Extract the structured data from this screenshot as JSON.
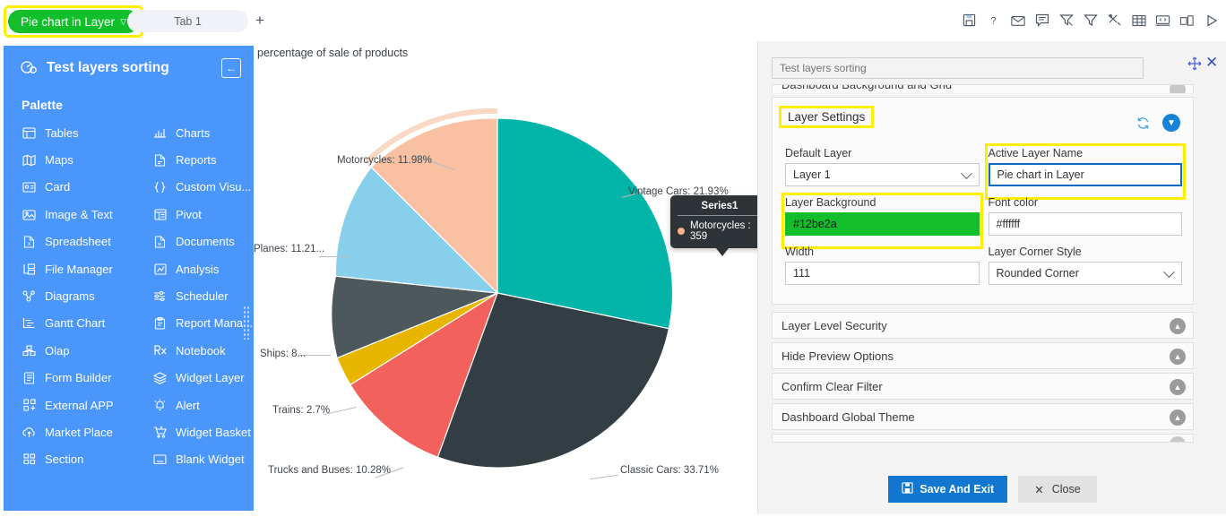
{
  "topbar": {
    "layer_pill": {
      "label": "Pie chart in Layer",
      "caret": "chevron-down-icon",
      "bg": "#12be2a"
    },
    "tab": {
      "label": "Tab 1"
    },
    "add_tab_label": "+",
    "icons": [
      {
        "name": "save-icon"
      },
      {
        "name": "help-icon"
      },
      {
        "name": "mail-icon"
      },
      {
        "name": "comment-icon"
      },
      {
        "name": "clear-filter-icon"
      },
      {
        "name": "filter-icon"
      },
      {
        "name": "tools-icon"
      },
      {
        "name": "table-icon"
      },
      {
        "name": "code-icon"
      },
      {
        "name": "duplicate-icon"
      },
      {
        "name": "play-icon"
      }
    ]
  },
  "sidebar": {
    "title": "Test layers sorting",
    "dashboard_icon": "dashboard-icon",
    "collapse_icon": "arrow-left-icon",
    "palette_label": "Palette",
    "bg": "#4a96fb",
    "items": [
      {
        "label": "Tables",
        "icon": "table-icon"
      },
      {
        "label": "Charts",
        "icon": "chart-icon"
      },
      {
        "label": "Maps",
        "icon": "map-icon"
      },
      {
        "label": "Reports",
        "icon": "report-icon"
      },
      {
        "label": "Card",
        "icon": "card-icon"
      },
      {
        "label": "Custom Visu...",
        "icon": "braces-icon"
      },
      {
        "label": "Image & Text",
        "icon": "image-text-icon"
      },
      {
        "label": "Pivot",
        "icon": "pivot-icon"
      },
      {
        "label": "Spreadsheet",
        "icon": "spreadsheet-icon"
      },
      {
        "label": "Documents",
        "icon": "document-icon"
      },
      {
        "label": "File Manager",
        "icon": "file-manager-icon"
      },
      {
        "label": "Analysis",
        "icon": "analysis-icon"
      },
      {
        "label": "Diagrams",
        "icon": "diagram-icon"
      },
      {
        "label": "Scheduler",
        "icon": "scheduler-icon"
      },
      {
        "label": "Gantt Chart",
        "icon": "gantt-icon"
      },
      {
        "label": "Report Mana...",
        "icon": "report-manager-icon"
      },
      {
        "label": "Olap",
        "icon": "olap-icon"
      },
      {
        "label": "Notebook",
        "icon": "notebook-icon"
      },
      {
        "label": "Form Builder",
        "icon": "form-builder-icon"
      },
      {
        "label": "Widget Layer",
        "icon": "layers-icon"
      },
      {
        "label": "External APP",
        "icon": "external-app-icon"
      },
      {
        "label": "Alert",
        "icon": "alert-bell-icon"
      },
      {
        "label": "Market Place",
        "icon": "market-place-icon"
      },
      {
        "label": "Widget Basket",
        "icon": "basket-icon"
      },
      {
        "label": "Section",
        "icon": "section-icon"
      },
      {
        "label": "Blank Widget",
        "icon": "blank-widget-icon"
      }
    ]
  },
  "chart_data": {
    "type": "pie",
    "title": "percentage of sale of products",
    "series_name": "Series1",
    "categories": [
      "Vintage Cars",
      "Classic Cars",
      "Trucks and Buses",
      "Trains",
      "Ships",
      "Planes",
      "Motorcycles"
    ],
    "values": [
      21.93,
      33.71,
      10.28,
      2.7,
      8,
      11.21,
      11.98
    ],
    "unit": "%",
    "labels": [
      {
        "text": "Vintage Cars: 21.93%",
        "color": "#03b5a9"
      },
      {
        "text": "Classic Cars: 33.71%",
        "color": "#323e43"
      },
      {
        "text": "Trucks and Buses: 10.28%",
        "color": "#f2615b"
      },
      {
        "text": "Trains: 2.7%",
        "color": "#e8b600"
      },
      {
        "text": "Ships: 8...",
        "color": "#4d585c"
      },
      {
        "text": "Planes: 11.21...",
        "color": "#87cfeb"
      },
      {
        "text": "Motorcycles: 11.98%",
        "color": "#f9c0a1"
      }
    ],
    "legend": "none",
    "grid": false,
    "tooltip": {
      "title": "Series1",
      "row_label": "Motorcycles : 359",
      "dot_color": "#f9b38b"
    }
  },
  "settings": {
    "search_placeholder": "Test layers sorting",
    "search_value": "",
    "move_icon": "move-icon",
    "close_icon": "close-icon",
    "cut_section_label": "Dashboard Background and Grid",
    "layer_settings": {
      "title": "Layer Settings",
      "refresh_icon": "refresh-icon",
      "toggle_icon": "chevron-down-icon",
      "fields": [
        {
          "label": "Default Layer",
          "value": "Layer 1",
          "type": "select"
        },
        {
          "label": "Active Layer Name",
          "value": "Pie chart in Layer",
          "type": "text"
        },
        {
          "label": "Layer Background",
          "value": "#12be2a",
          "type": "color"
        },
        {
          "label": "Font color",
          "value": "#ffffff",
          "type": "text"
        },
        {
          "label": "Width",
          "value": "111",
          "type": "text"
        },
        {
          "label": "Layer Corner Style",
          "value": "Rounded Corner",
          "type": "select"
        }
      ]
    },
    "sections": [
      {
        "label": "Layer Level Security"
      },
      {
        "label": "Hide Preview Options"
      },
      {
        "label": "Confirm Clear Filter"
      },
      {
        "label": "Dashboard Global Theme"
      }
    ],
    "footer": {
      "save_label": "Save And Exit",
      "save_icon": "floppy-icon",
      "close_label": "Close",
      "close_icon": "x-icon"
    }
  }
}
